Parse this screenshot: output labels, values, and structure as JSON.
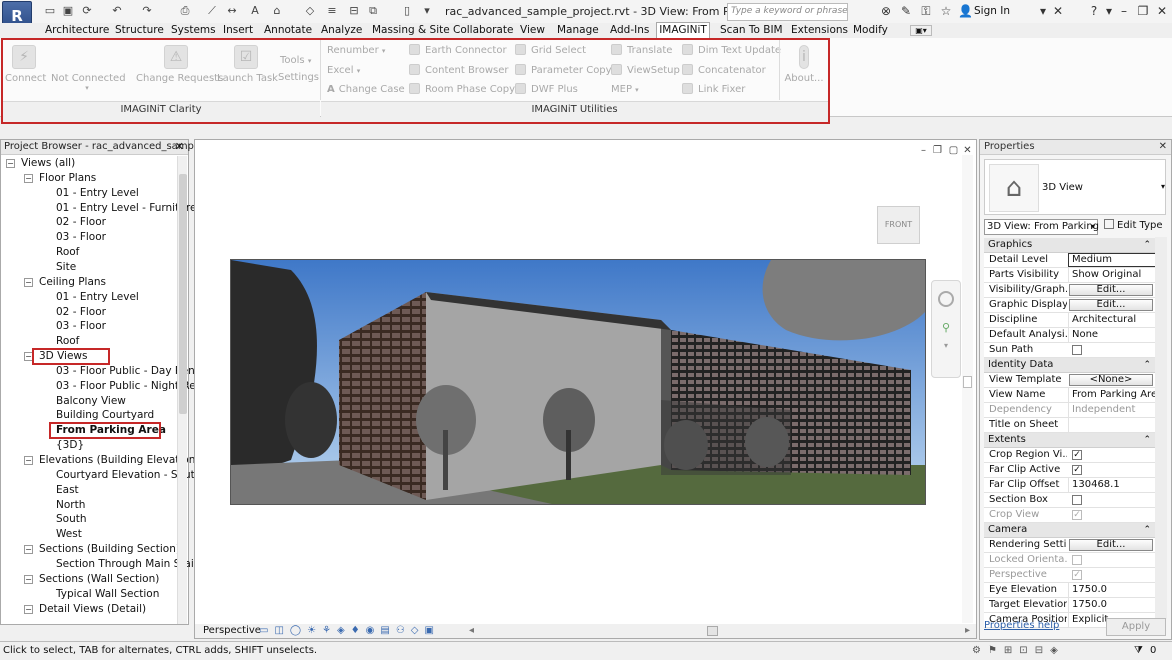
{
  "app": {
    "logo": "R",
    "title": "rac_advanced_sample_project.rvt - 3D View: From P..."
  },
  "search": {
    "placeholder": "Type a keyword or phrase"
  },
  "account": {
    "signin": "Sign In"
  },
  "tabs": [
    "Architecture",
    "Structure",
    "Systems",
    "Insert",
    "Annotate",
    "Analyze",
    "Massing & Site",
    "Collaborate",
    "View",
    "Manage",
    "Add-Ins",
    "IMAGINiT",
    "Scan To BIM",
    "Extensions",
    "Modify"
  ],
  "active_tab": "IMAGINiT",
  "ribbon": {
    "clarity": {
      "label": "IMAGINiT Clarity",
      "connect": "Connect",
      "not_connected": "Not Connected",
      "change_requests": "Change Requests",
      "launch_task": "Launch Task",
      "tools": "Tools",
      "settings": "Settings"
    },
    "utilities": {
      "label": "IMAGINiT Utilities",
      "renumber": "Renumber",
      "excel": "Excel",
      "change_case": "Change Case",
      "earth_connector": "Earth Connector",
      "content_browser": "Content Browser",
      "room_phase_copy": "Room Phase Copy",
      "grid_select": "Grid Select",
      "parameter_copy": "Parameter Copy",
      "dwf_plus": "DWF Plus",
      "translate": "Translate",
      "viewsetup": "ViewSetup",
      "mep": "MEP",
      "dim_text_update": "Dim Text Update",
      "concatenator": "Concatenator",
      "link_fixer": "Link Fixer",
      "about": "About..."
    }
  },
  "project_browser": {
    "title": "Project Browser - rac_advanced_sampl...",
    "tree": [
      {
        "label": "Views (all)",
        "level": 0,
        "toggle": "−"
      },
      {
        "label": "Floor Plans",
        "level": 1,
        "toggle": "−"
      },
      {
        "label": "01 - Entry Level",
        "level": 2
      },
      {
        "label": "01 - Entry Level - Furniture",
        "level": 2
      },
      {
        "label": "02 - Floor",
        "level": 2
      },
      {
        "label": "03 - Floor",
        "level": 2
      },
      {
        "label": "Roof",
        "level": 2
      },
      {
        "label": "Site",
        "level": 2
      },
      {
        "label": "Ceiling Plans",
        "level": 1,
        "toggle": "−"
      },
      {
        "label": "01 - Entry Level",
        "level": 2
      },
      {
        "label": "02 - Floor",
        "level": 2
      },
      {
        "label": "03 - Floor",
        "level": 2
      },
      {
        "label": "Roof",
        "level": 2
      },
      {
        "label": "3D Views",
        "level": 1,
        "toggle": "−",
        "highlight": true
      },
      {
        "label": "03 - Floor Public - Day Rend",
        "level": 2
      },
      {
        "label": "03 - Floor Public - Night Re",
        "level": 2
      },
      {
        "label": "Balcony View",
        "level": 2
      },
      {
        "label": "Building Courtyard",
        "level": 2
      },
      {
        "label": "From Parking Area",
        "level": 2,
        "bold": true,
        "highlight": true
      },
      {
        "label": "{3D}",
        "level": 2
      },
      {
        "label": "Elevations (Building Elevation)",
        "level": 1,
        "toggle": "−"
      },
      {
        "label": "Courtyard Elevation - South",
        "level": 2
      },
      {
        "label": "East",
        "level": 2
      },
      {
        "label": "North",
        "level": 2
      },
      {
        "label": "South",
        "level": 2
      },
      {
        "label": "West",
        "level": 2
      },
      {
        "label": "Sections (Building Section)",
        "level": 1,
        "toggle": "−"
      },
      {
        "label": "Section Through Main Stai",
        "level": 2
      },
      {
        "label": "Sections (Wall Section)",
        "level": 1,
        "toggle": "−"
      },
      {
        "label": "Typical Wall Section",
        "level": 2
      },
      {
        "label": "Detail Views (Detail)",
        "level": 1,
        "toggle": "−"
      }
    ]
  },
  "viewport": {
    "viewcube_label": "FRONT",
    "view_mode": "Perspective"
  },
  "properties": {
    "title": "Properties",
    "type_name": "3D View",
    "selector": "3D View: From Parking",
    "edit_type": "Edit Type",
    "groups": [
      {
        "name": "Graphics",
        "rows": [
          {
            "k": "Detail Level",
            "v": "Medium",
            "style": "boxed"
          },
          {
            "k": "Parts Visibility",
            "v": "Show Original"
          },
          {
            "k": "Visibility/Graph...",
            "v": "Edit...",
            "style": "btn"
          },
          {
            "k": "Graphic Display...",
            "v": "Edit...",
            "style": "btn"
          },
          {
            "k": "Discipline",
            "v": "Architectural"
          },
          {
            "k": "Default Analysi...",
            "v": "None"
          },
          {
            "k": "Sun Path",
            "check": false
          }
        ]
      },
      {
        "name": "Identity Data",
        "rows": [
          {
            "k": "View Template",
            "v": "<None>",
            "style": "btn"
          },
          {
            "k": "View Name",
            "v": "From Parking Area"
          },
          {
            "k": "Dependency",
            "v": "Independent",
            "dim": true
          },
          {
            "k": "Title on Sheet",
            "v": ""
          }
        ]
      },
      {
        "name": "Extents",
        "rows": [
          {
            "k": "Crop Region Vi...",
            "check": true
          },
          {
            "k": "Far Clip Active",
            "check": true
          },
          {
            "k": "Far Clip Offset",
            "v": "130468.1"
          },
          {
            "k": "Section Box",
            "check": false
          },
          {
            "k": "Crop View",
            "check": true,
            "dim": true
          }
        ]
      },
      {
        "name": "Camera",
        "rows": [
          {
            "k": "Rendering Setti...",
            "v": "Edit...",
            "style": "btn"
          },
          {
            "k": "Locked Orienta...",
            "check": false,
            "dim": true
          },
          {
            "k": "Perspective",
            "check": true,
            "dim": true
          },
          {
            "k": "Eye Elevation",
            "v": "1750.0"
          },
          {
            "k": "Target Elevation",
            "v": "1750.0"
          },
          {
            "k": "Camera Position",
            "v": "Explicit"
          }
        ]
      }
    ],
    "help_link": "Properties help",
    "apply": "Apply"
  },
  "status": {
    "text": "Click to select, TAB for alternates, CTRL adds, SHIFT unselects.",
    "filter_count": "0"
  }
}
